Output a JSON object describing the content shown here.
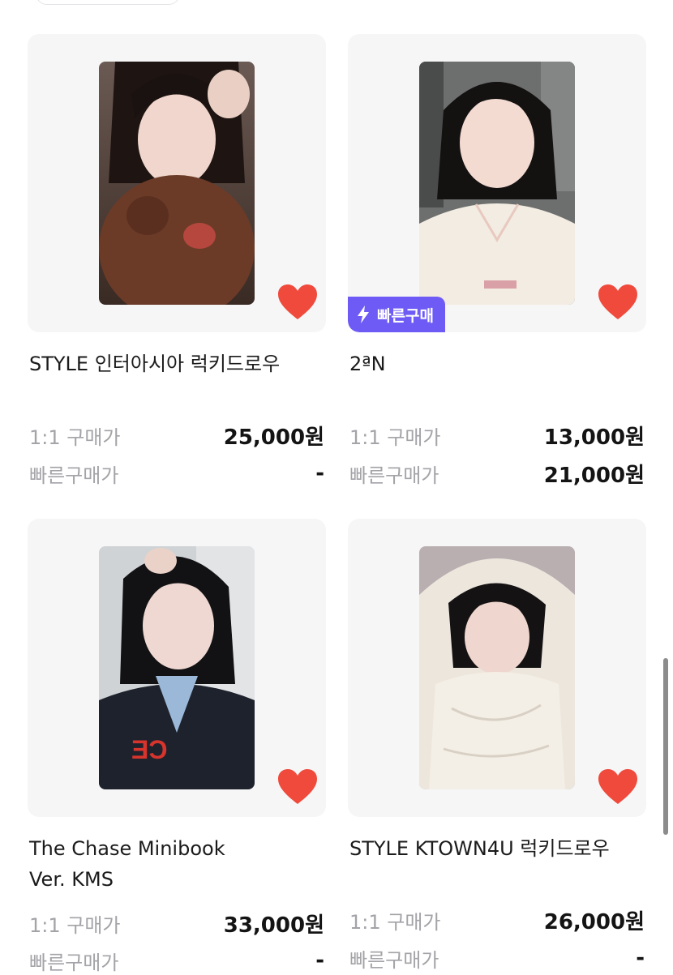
{
  "products": [
    {
      "title": "STYLE 인터아시아 럭키드로우",
      "prices": [
        {
          "label": "1:1 구매가",
          "value": "25,000원"
        },
        {
          "label": "빠른구매가",
          "value": "-"
        }
      ],
      "fast_purchase_badge": "",
      "liked": true
    },
    {
      "title": "2ªN",
      "prices": [
        {
          "label": "1:1 구매가",
          "value": "13,000원"
        },
        {
          "label": "빠른구매가",
          "value": "21,000원"
        }
      ],
      "fast_purchase_badge": "빠른구매",
      "liked": true
    },
    {
      "title": "The Chase Minibook\nVer. KMS",
      "prices": [
        {
          "label": "1:1 구매가",
          "value": "33,000원"
        },
        {
          "label": "빠른구매가",
          "value": "-"
        }
      ],
      "fast_purchase_badge": "",
      "liked": true
    },
    {
      "title": "STYLE KTOWN4U 럭키드로우",
      "prices": [
        {
          "label": "1:1 구매가",
          "value": "26,000원"
        },
        {
          "label": "빠른구매가",
          "value": "-"
        }
      ],
      "fast_purchase_badge": "",
      "liked": true
    }
  ],
  "icons": {
    "like": "heart-icon",
    "fast": "lightning-icon"
  },
  "colors": {
    "heart": "#f04a3c",
    "badge": "#6e5bf5",
    "card_bg": "#f6f6f7",
    "label_gray": "#a3a3a8"
  }
}
